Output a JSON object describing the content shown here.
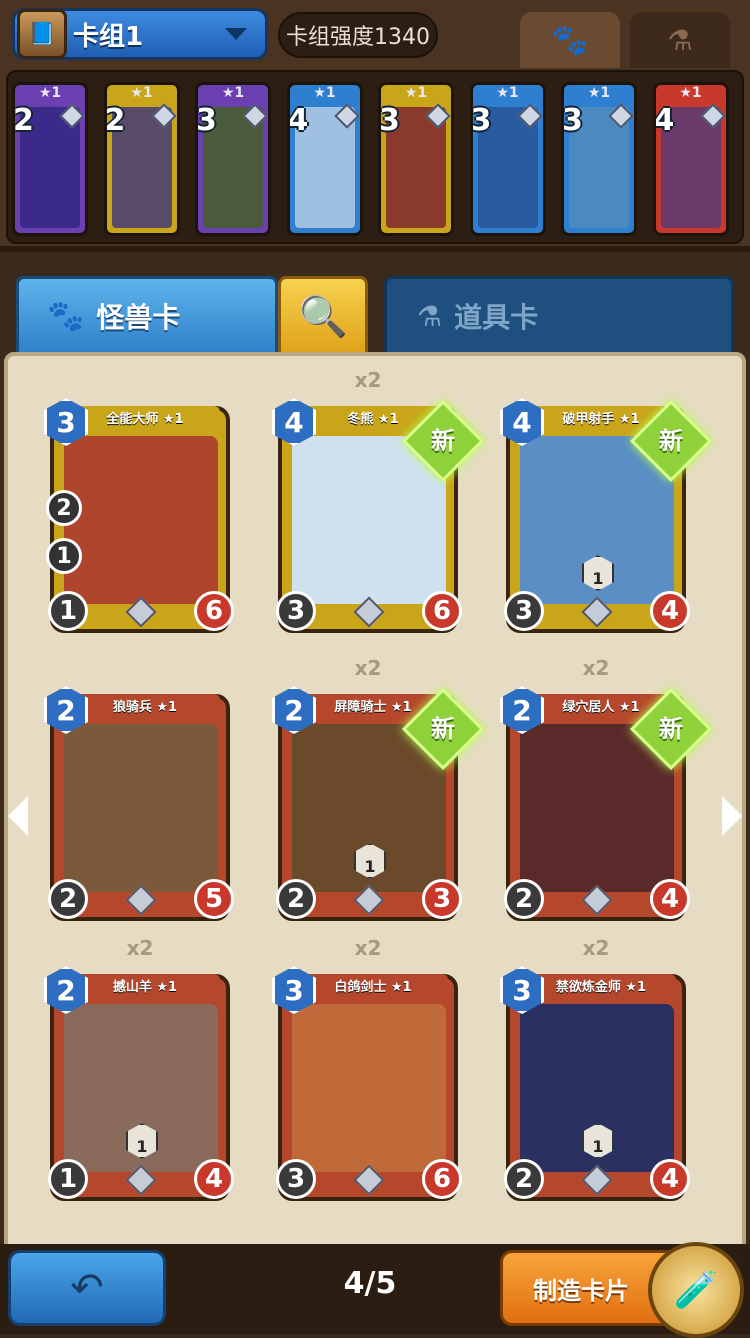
{
  "header": {
    "deck_name": "卡组1",
    "deck_power": "卡组强度1340"
  },
  "deck_cards": [
    {
      "stars": "★1",
      "cost": "2",
      "frame": "#6a3fb0",
      "art": "#3b2a8a"
    },
    {
      "stars": "★1",
      "cost": "2",
      "frame": "#c9a51a",
      "art": "#5a4a6a"
    },
    {
      "stars": "★1",
      "cost": "3",
      "frame": "#6a3fb0",
      "art": "#4a5a3a"
    },
    {
      "stars": "★1",
      "cost": "4",
      "frame": "#2f7fd0",
      "art": "#9fc0e0"
    },
    {
      "stars": "★1",
      "cost": "3",
      "frame": "#c9a51a",
      "art": "#8a3a2a"
    },
    {
      "stars": "★1",
      "cost": "3",
      "frame": "#2f7fd0",
      "art": "#2a5aa0"
    },
    {
      "stars": "★1",
      "cost": "3",
      "frame": "#2f7fd0",
      "art": "#4a8ac0"
    },
    {
      "stars": "★1",
      "cost": "4",
      "frame": "#c8392b",
      "art": "#6a3a6a"
    }
  ],
  "tabs": {
    "monster": "怪兽卡",
    "item": "道具卡"
  },
  "cards": [
    {
      "name": "全能大师 ★1",
      "cost": "3",
      "atk": "1",
      "hp": "6",
      "copies": "",
      "new": false,
      "frame": "#c9a51a",
      "art": "#b0452e",
      "side1": "2",
      "side2": "1"
    },
    {
      "name": "冬熊 ★1",
      "cost": "4",
      "atk": "3",
      "hp": "6",
      "copies": "x2",
      "new": true,
      "frame": "#c9a51a",
      "art": "#cfe0ee"
    },
    {
      "name": "破甲射手 ★1",
      "cost": "4",
      "atk": "3",
      "hp": "4",
      "copies": "",
      "new": true,
      "frame": "#c9a51a",
      "art": "#5a8ec4",
      "mid": "1"
    },
    {
      "name": "狼骑兵 ★1",
      "cost": "2",
      "atk": "2",
      "hp": "5",
      "copies": "",
      "new": false,
      "frame": "#b5482c",
      "art": "#7a5a3a"
    },
    {
      "name": "屏障骑士 ★1",
      "cost": "2",
      "atk": "2",
      "hp": "3",
      "copies": "x2",
      "new": true,
      "frame": "#b5482c",
      "art": "#6a4a2a",
      "mid": "1"
    },
    {
      "name": "绿穴居人 ★1",
      "cost": "2",
      "atk": "2",
      "hp": "4",
      "copies": "x2",
      "new": true,
      "frame": "#b5482c",
      "art": "#5a2a2a"
    },
    {
      "name": "撼山羊 ★1",
      "cost": "2",
      "atk": "1",
      "hp": "4",
      "copies": "x2",
      "new": false,
      "frame": "#b5482c",
      "art": "#8a6a5a",
      "mid": "1"
    },
    {
      "name": "白鸽剑士 ★1",
      "cost": "3",
      "atk": "3",
      "hp": "6",
      "copies": "x2",
      "new": false,
      "frame": "#b5482c",
      "art": "#c06a3a"
    },
    {
      "name": "禁欲炼金师 ★1",
      "cost": "3",
      "atk": "2",
      "hp": "4",
      "copies": "x2",
      "new": false,
      "frame": "#b5482c",
      "art": "#2a3060",
      "mid": "1"
    }
  ],
  "new_badge": "新",
  "footer": {
    "page": "4/5",
    "craft": "制造卡片"
  }
}
